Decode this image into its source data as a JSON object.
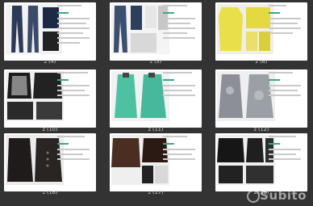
{
  "thumbnails": [
    {
      "caption": "z (4)"
    },
    {
      "caption": "z (5)"
    },
    {
      "caption": "z (6)"
    },
    {
      "caption": "z (10)"
    },
    {
      "caption": "z (11)"
    },
    {
      "caption": "z (12)"
    },
    {
      "caption": "z (16)"
    },
    {
      "caption": "z (17)"
    },
    {
      "caption": "z (18)"
    }
  ],
  "watermark": {
    "text": "Subito"
  },
  "colors": {
    "background": "#333333",
    "caption_text": "#d8d8d8",
    "accent": "#3aa88a"
  }
}
